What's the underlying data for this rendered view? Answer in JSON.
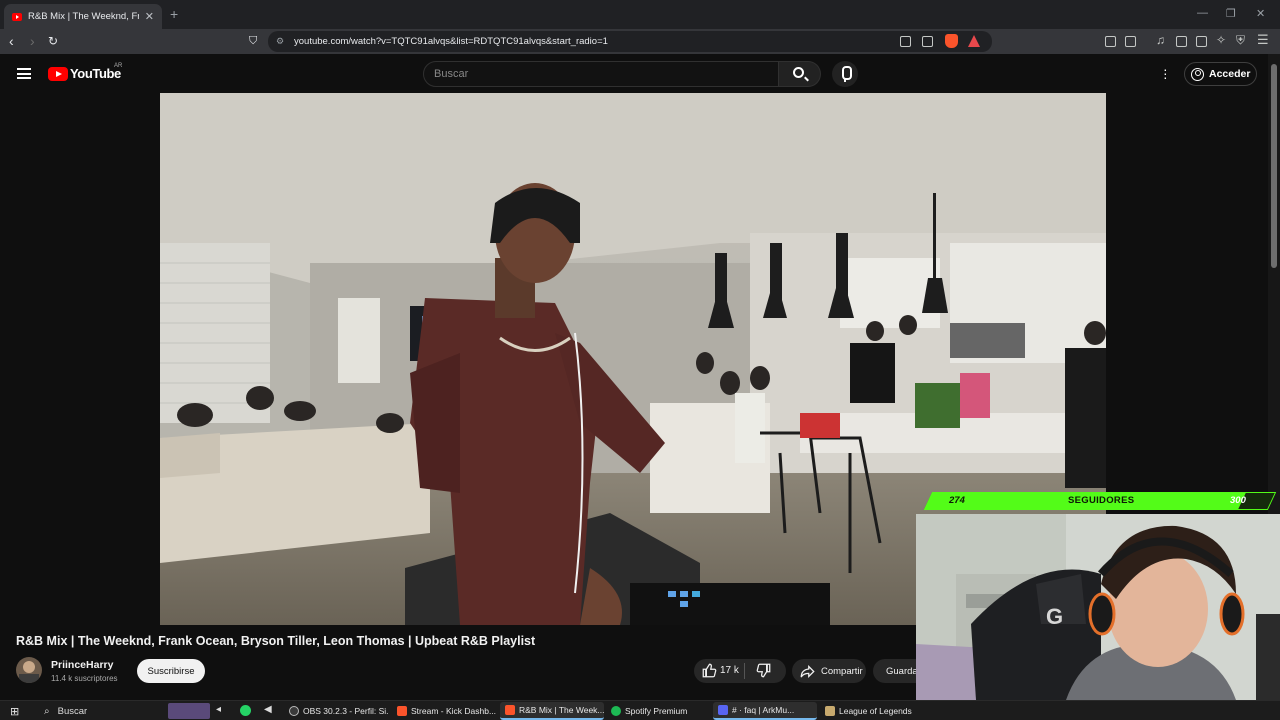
{
  "browser": {
    "tab_title": "R&B Mix | The Weeknd, Frank",
    "new_tab": "+",
    "url": "youtube.com/watch?v=TQTC91alvqs&list=RDTQTC91alvqs&start_radio=1"
  },
  "youtube": {
    "logo_text": "YouTube",
    "country": "AR",
    "search_placeholder": "Buscar",
    "sign_in": "Acceder"
  },
  "video": {
    "title": "R&B Mix | The Weeknd, Frank Ocean, Bryson Tiller, Leon Thomas | Upbeat R&B Playlist",
    "channel": "PriinceHarry",
    "subscribers": "11.4 k suscriptores",
    "subscribe_label": "Suscribirse",
    "likes": "17 k",
    "share_label": "Compartir",
    "save_label": "Guardar"
  },
  "overlay": {
    "followers_current": "274",
    "followers_label": "SEGUIDORES",
    "followers_goal": "300",
    "progress": 0.913
  },
  "taskbar": {
    "search_label": "Buscar",
    "items": [
      {
        "label": "OBS 30.2.3 - Perfil: Si...",
        "color": "#3a3a3a"
      },
      {
        "label": "Stream - Kick Dashb...",
        "color": "#fb542b"
      },
      {
        "label": "R&B Mix | The Week...",
        "color": "#fb542b"
      },
      {
        "label": "Spotify Premium",
        "color": "#1db954"
      },
      {
        "label": "# · faq | ArkMu...",
        "color": "#5865f2"
      },
      {
        "label": "League of Legends",
        "color": "#c8aa6e"
      }
    ]
  },
  "colors": {
    "youtube_red": "#ff0000",
    "kick_green": "#53fc18"
  }
}
